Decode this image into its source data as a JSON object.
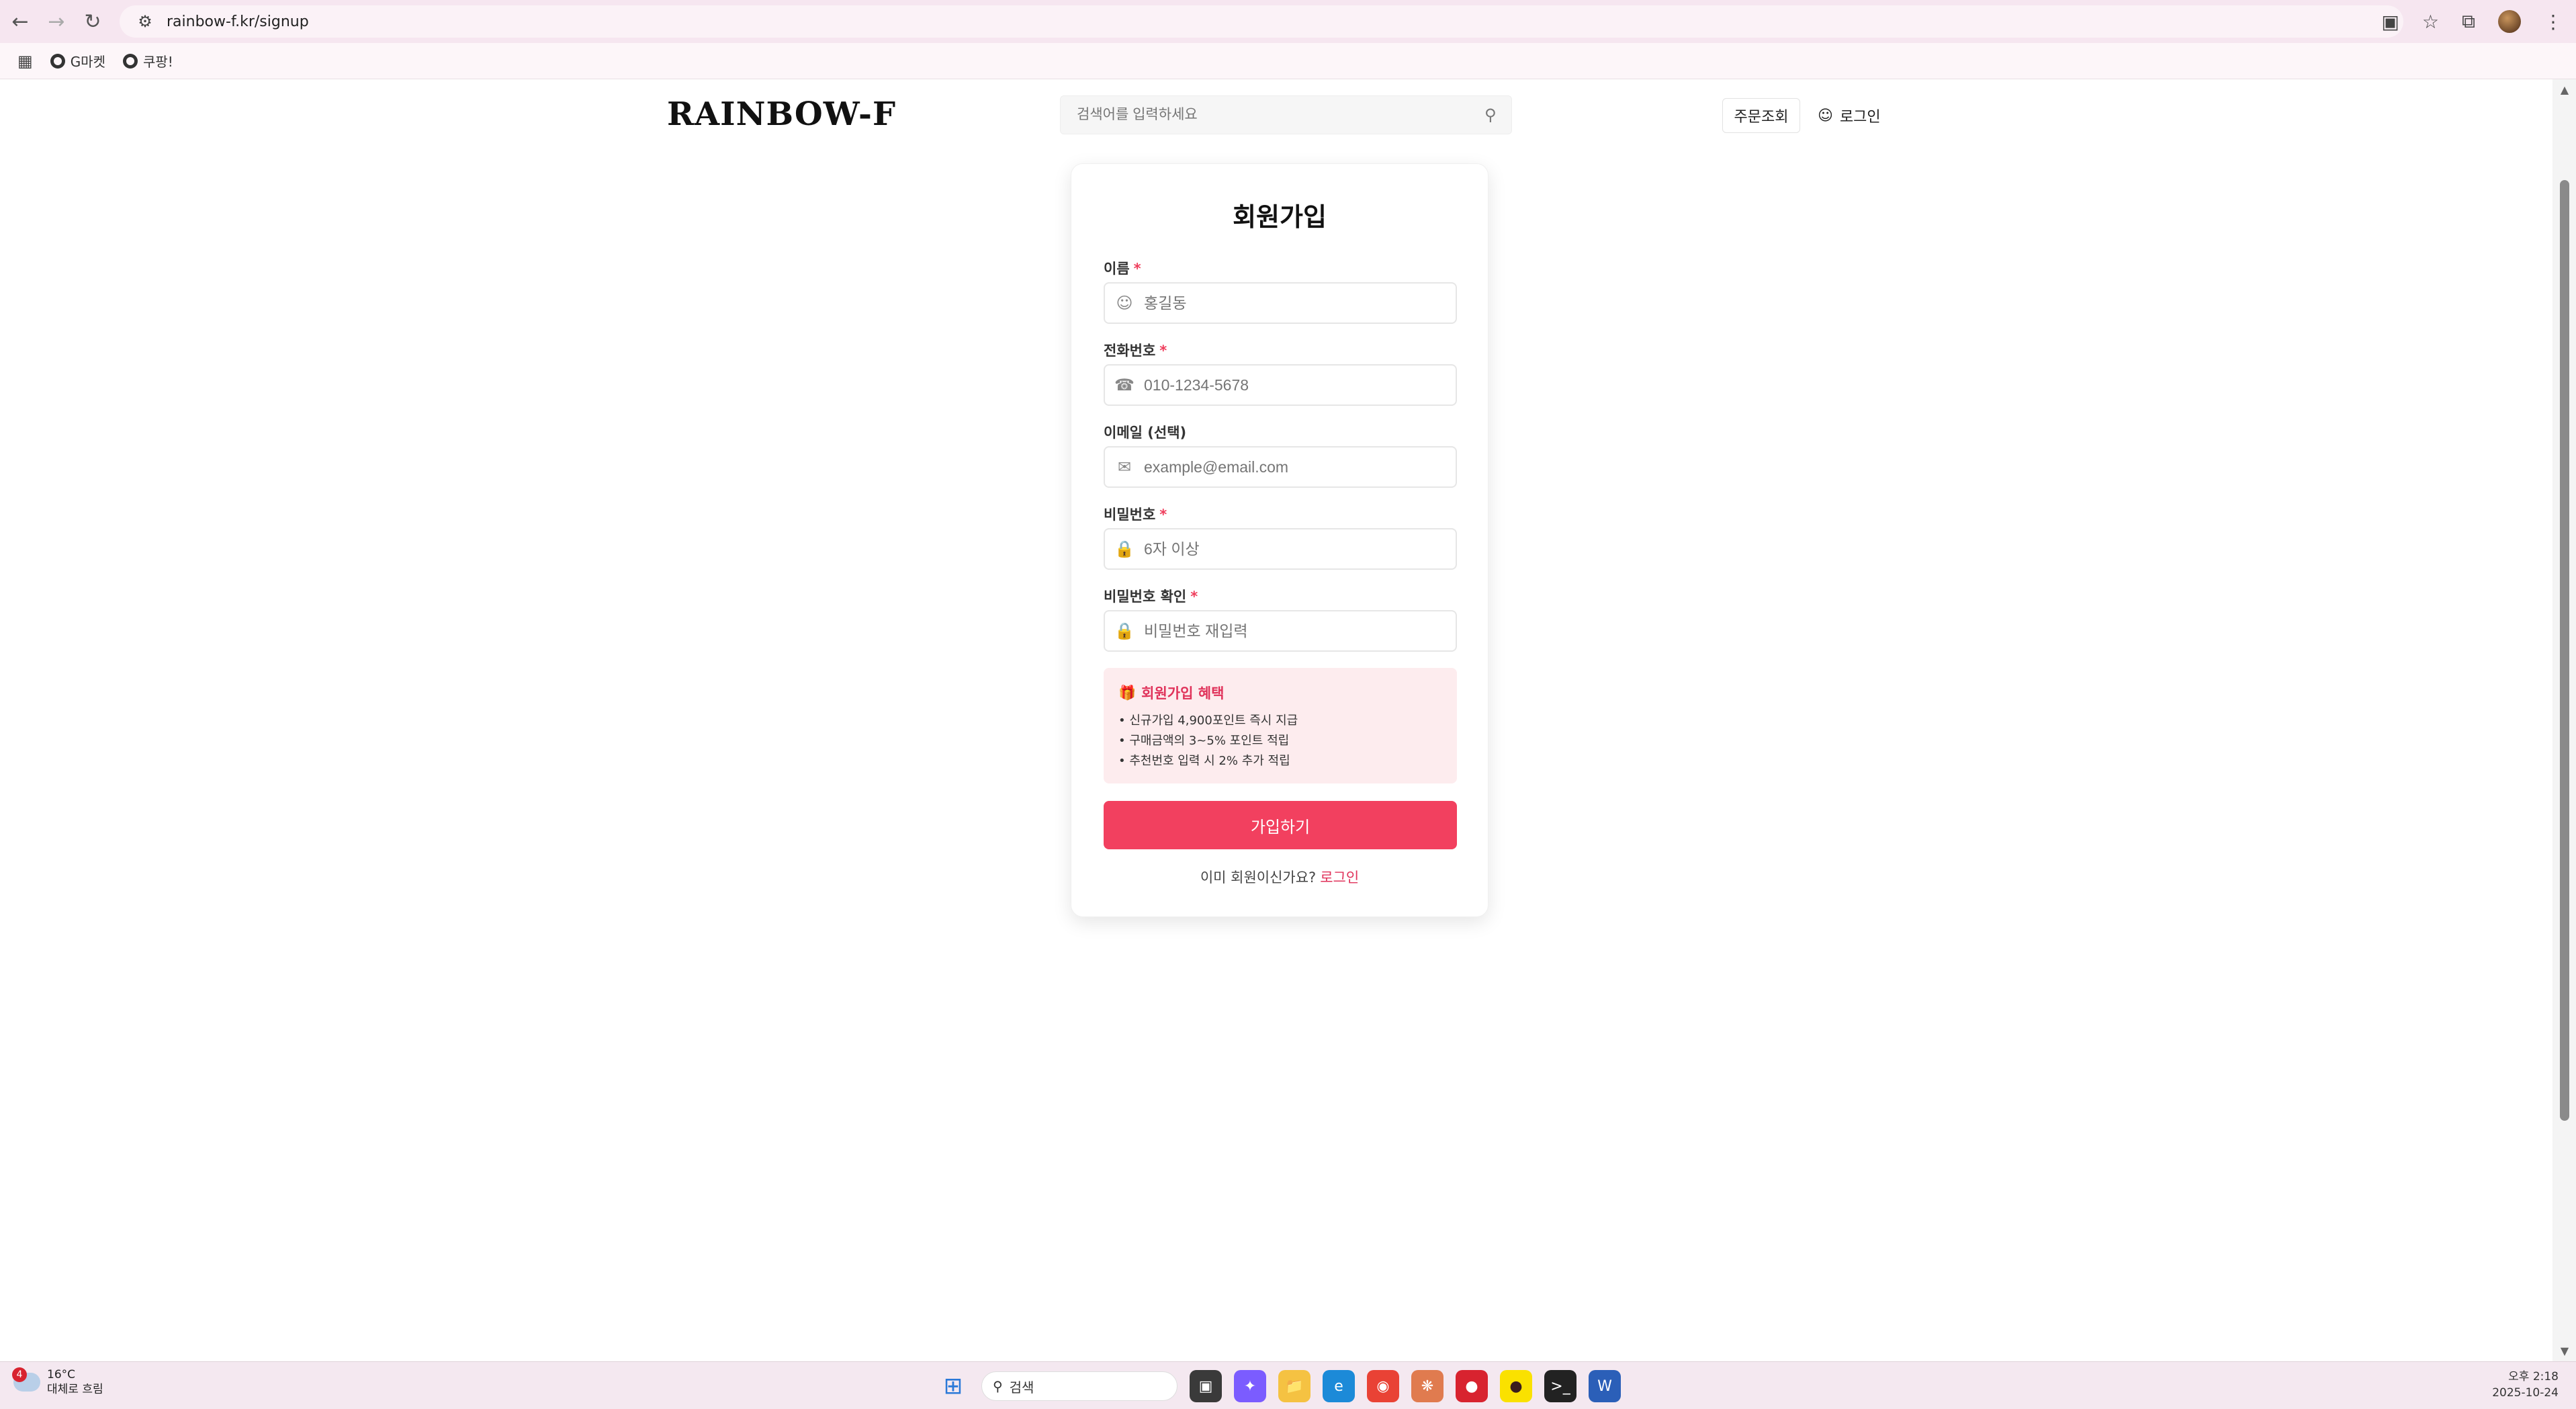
{
  "browser": {
    "url": "rainbow-f.kr/signup",
    "bookmarks": [
      {
        "label": "G마켓"
      },
      {
        "label": "쿠팡!"
      }
    ]
  },
  "header": {
    "logo": "RAINBOW-F",
    "search_placeholder": "검색어를 입력하세요",
    "order_lookup": "주문조회",
    "login": "로그인"
  },
  "form": {
    "title": "회원가입",
    "required_mark": "*",
    "fields": [
      {
        "label": "이름",
        "required": true,
        "placeholder": "홍길동",
        "icon": "user-icon"
      },
      {
        "label": "전화번호",
        "required": true,
        "placeholder": "010-1234-5678",
        "icon": "phone-icon"
      },
      {
        "label": "이메일 (선택)",
        "required": false,
        "placeholder": "example@email.com",
        "icon": "mail-icon"
      },
      {
        "label": "비밀번호",
        "required": true,
        "placeholder": "6자 이상",
        "icon": "lock-icon"
      },
      {
        "label": "비밀번호 확인",
        "required": true,
        "placeholder": "비밀번호 재입력",
        "icon": "lock-icon"
      }
    ],
    "benefit": {
      "title": "회원가입 혜택",
      "items": [
        "• 신규가입 4,900포인트 즉시 지급",
        "• 구매금액의 3~5% 포인트 적립",
        "• 추천번호 입력 시 2% 추가 적립"
      ]
    },
    "submit_label": "가입하기",
    "already_text": "이미 회원이신가요?",
    "login_link": "로그인"
  },
  "taskbar": {
    "weather_badge": "4",
    "temperature": "16°C",
    "weather_desc": "대체로 흐림",
    "search_label": "검색",
    "time": "오후 2:18",
    "date": "2025-10-24"
  },
  "colors": {
    "accent": "#f2405f",
    "benefit_bg": "#fdecee",
    "chrome_bg": "#f6e6f0"
  }
}
